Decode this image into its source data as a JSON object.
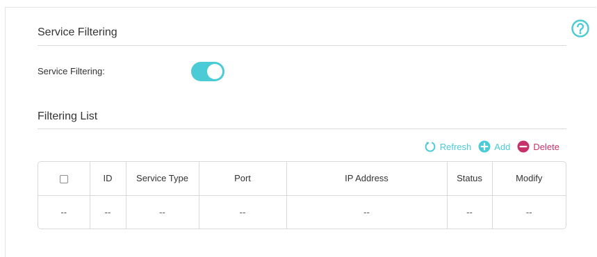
{
  "service_filtering_section": {
    "title": "Service Filtering",
    "toggle_label": "Service Filtering:",
    "toggle_state": "on",
    "toggle_color": "#4acbd6"
  },
  "help_icon": "help-circle-icon",
  "filtering_list_section": {
    "title": "Filtering List",
    "actions": {
      "refresh_label": "Refresh",
      "add_label": "Add",
      "delete_label": "Delete"
    },
    "columns": [
      "ID",
      "Service Type",
      "Port",
      "IP Address",
      "Status",
      "Modify"
    ],
    "rows": [
      {
        "select": "--",
        "id": "--",
        "service_type": "--",
        "port": "--",
        "ip_address": "--",
        "status": "--",
        "modify": "--"
      }
    ]
  },
  "colors": {
    "accent": "#4acbd6",
    "delete": "#c8326b"
  }
}
